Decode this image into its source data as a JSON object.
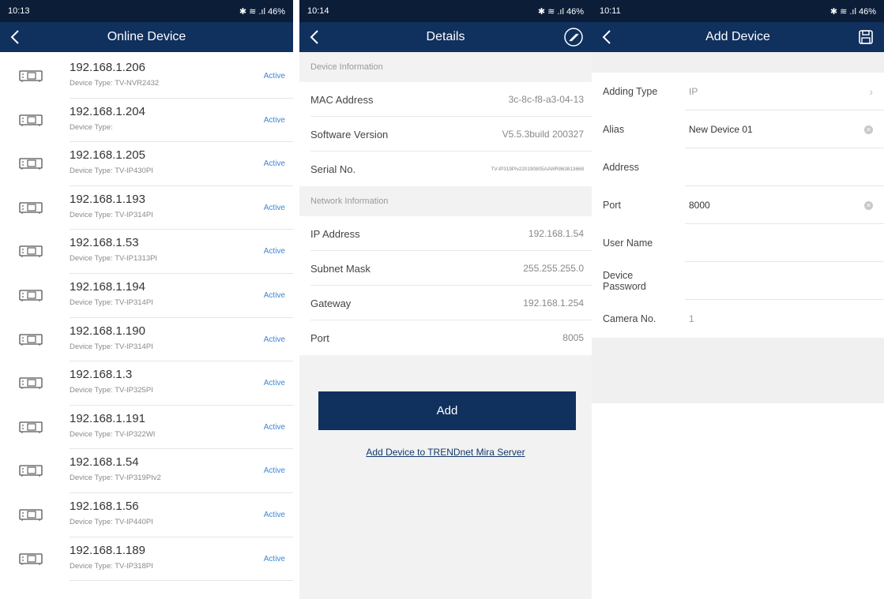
{
  "screen1": {
    "status": {
      "time": "10:13",
      "right": "✱ ≋ .ıl 46%"
    },
    "title": "Online Device",
    "devices": [
      {
        "ip": "192.168.1.206",
        "type": "Device Type: TV-NVR2432",
        "status": "Active"
      },
      {
        "ip": "192.168.1.204",
        "type": "Device Type:",
        "status": "Active"
      },
      {
        "ip": "192.168.1.205",
        "type": "Device Type: TV-IP430PI",
        "status": "Active"
      },
      {
        "ip": "192.168.1.193",
        "type": "Device Type: TV-IP314PI",
        "status": "Active"
      },
      {
        "ip": "192.168.1.53",
        "type": "Device Type: TV-IP1313PI",
        "status": "Active"
      },
      {
        "ip": "192.168.1.194",
        "type": "Device Type: TV-IP314PI",
        "status": "Active"
      },
      {
        "ip": "192.168.1.190",
        "type": "Device Type: TV-IP314PI",
        "status": "Active"
      },
      {
        "ip": "192.168.1.3",
        "type": "Device Type: TV-IP325PI",
        "status": "Active"
      },
      {
        "ip": "192.168.1.191",
        "type": "Device Type: TV-IP322WI",
        "status": "Active"
      },
      {
        "ip": "192.168.1.54",
        "type": "Device Type: TV-IP319PIv2",
        "status": "Active"
      },
      {
        "ip": "192.168.1.56",
        "type": "Device Type: TV-IP440PI",
        "status": "Active"
      },
      {
        "ip": "192.168.1.189",
        "type": "Device Type: TV-IP318PI",
        "status": "Active"
      }
    ]
  },
  "screen2": {
    "status": {
      "time": "10:14",
      "right": "✱ ≋ .ıl 46%"
    },
    "title": "Details",
    "device_info_header": "Device Information",
    "device_info": [
      {
        "key": "MAC Address",
        "value": "3c-8c-f8-a3-04-13"
      },
      {
        "key": "Software Version",
        "value": "V5.5.3build 200327"
      },
      {
        "key": "Serial No.",
        "value": "TV-IP319PIv220190805AAWR863813668"
      }
    ],
    "network_info_header": "Network Information",
    "network_info": [
      {
        "key": "IP Address",
        "value": "192.168.1.54"
      },
      {
        "key": "Subnet Mask",
        "value": "255.255.255.0"
      },
      {
        "key": "Gateway",
        "value": "192.168.1.254"
      },
      {
        "key": "Port",
        "value": "8005"
      }
    ],
    "add_button": "Add",
    "mira_link": "Add Device to TRENDnet Mira Server"
  },
  "screen3": {
    "status": {
      "time": "10:11",
      "right": "✱ ≋ .ıl 46%"
    },
    "title": "Add Device",
    "fields": {
      "adding_type": {
        "label": "Adding Type",
        "value": "IP"
      },
      "alias": {
        "label": "Alias",
        "value": "New Device 01"
      },
      "address": {
        "label": "Address",
        "value": ""
      },
      "port": {
        "label": "Port",
        "value": "8000"
      },
      "user_name": {
        "label": "User Name",
        "value": ""
      },
      "device_password": {
        "label": "Device Password",
        "value": ""
      },
      "camera_no": {
        "label": "Camera No.",
        "value": "1"
      }
    }
  }
}
